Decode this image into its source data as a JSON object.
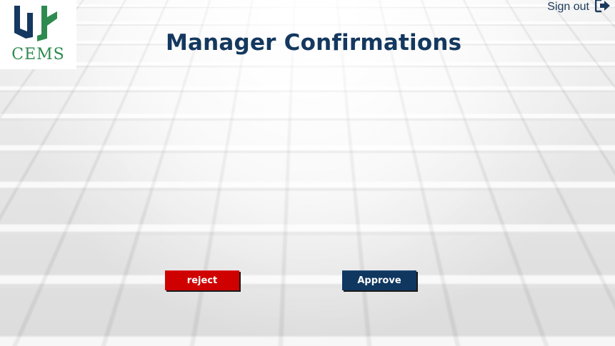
{
  "brand": {
    "name": "CEMS",
    "colors": {
      "primary": "#14385f",
      "green": "#2e8b4f"
    }
  },
  "header": {
    "signout_label": "Sign out",
    "signout_icon": "sign-out-icon"
  },
  "page": {
    "title": "Manager Confirmations"
  },
  "actions": {
    "reject_label": "reject",
    "reject_color": "#cf0000",
    "approve_label": "Approve",
    "approve_color": "#0f3760"
  }
}
